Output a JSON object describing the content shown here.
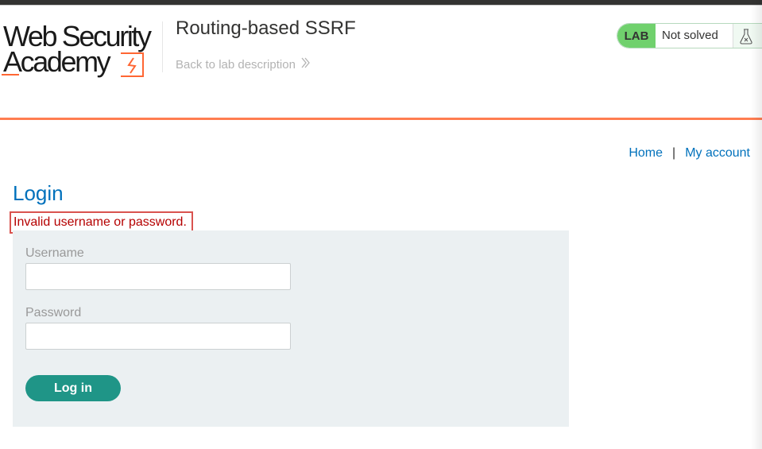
{
  "brand": {
    "line1": "Web Security",
    "line2": "Academy",
    "logo_icon": "lightning-bolt-icon"
  },
  "lab": {
    "title": "Routing-based SSRF",
    "back_link": "Back to lab description",
    "back_icon": "double-chevron-right-icon"
  },
  "status": {
    "badge": "LAB",
    "text": "Not solved",
    "icon": "flask-icon"
  },
  "nav": {
    "home": "Home",
    "separator": "|",
    "account": "My account"
  },
  "page": {
    "heading": "Login",
    "error": "Invalid username or password."
  },
  "form": {
    "username_label": "Username",
    "username_value": "",
    "password_label": "Password",
    "password_value": "",
    "submit_label": "Log in"
  },
  "colors": {
    "accent_orange": "#ff6633",
    "link_blue": "#0071bc",
    "button_teal": "#1f9587",
    "status_green": "#70d16d",
    "error_red": "#b50000"
  }
}
